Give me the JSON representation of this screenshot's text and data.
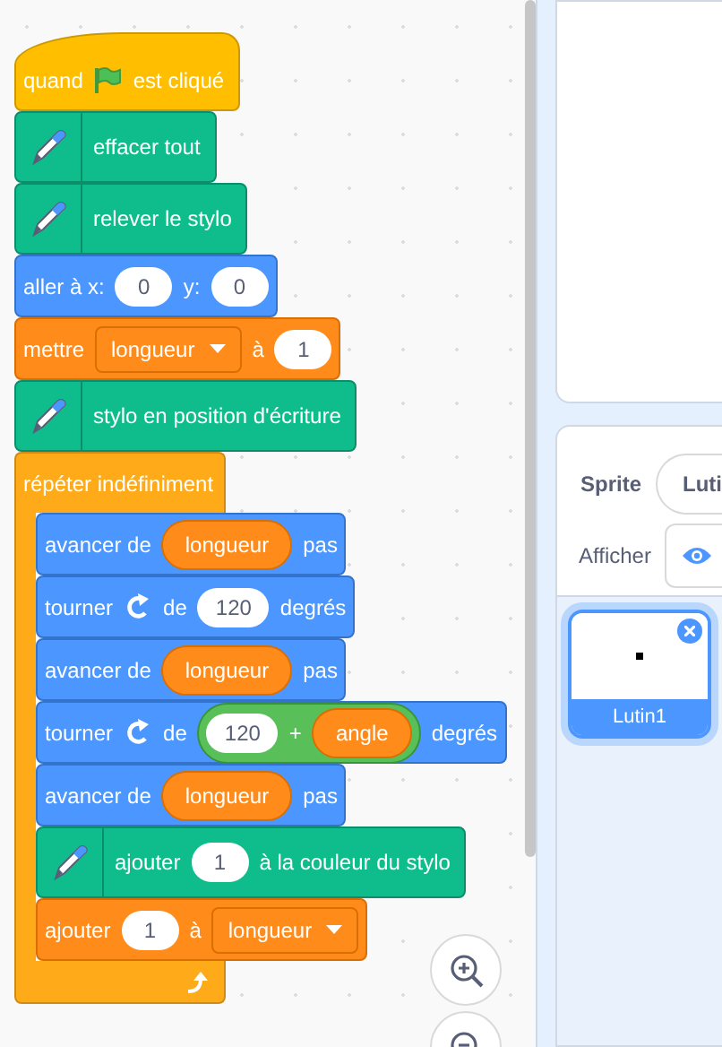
{
  "code_area": {
    "script": [
      {
        "kind": "hat",
        "parts": [
          {
            "kind": "text",
            "text": "quand"
          },
          {
            "kind": "flag"
          },
          {
            "kind": "text",
            "text": "est cliqué"
          }
        ]
      },
      {
        "kind": "pen",
        "parts": [
          {
            "kind": "text",
            "text": "effacer tout"
          }
        ]
      },
      {
        "kind": "pen",
        "parts": [
          {
            "kind": "text",
            "text": "relever le stylo"
          }
        ]
      },
      {
        "kind": "motion",
        "parts": [
          {
            "kind": "text",
            "text": "aller à x:"
          },
          {
            "kind": "number",
            "text": "0"
          },
          {
            "kind": "text",
            "text": "y:"
          },
          {
            "kind": "number",
            "text": "0"
          }
        ]
      },
      {
        "kind": "variables",
        "parts": [
          {
            "kind": "text",
            "text": "mettre"
          },
          {
            "kind": "dropdown",
            "text": "longueur"
          },
          {
            "kind": "text",
            "text": "à"
          },
          {
            "kind": "number",
            "text": "1"
          }
        ]
      },
      {
        "kind": "pen",
        "parts": [
          {
            "kind": "text",
            "text": "stylo en position d'écriture"
          }
        ]
      },
      {
        "kind": "control",
        "parts": [
          {
            "kind": "text",
            "text": "répéter indéfiniment"
          }
        ],
        "body": [
          {
            "kind": "motion",
            "parts": [
              {
                "kind": "text",
                "text": "avancer de"
              },
              {
                "kind": "reporter",
                "text": "longueur"
              },
              {
                "kind": "text",
                "text": "pas"
              }
            ]
          },
          {
            "kind": "motion",
            "parts": [
              {
                "kind": "text",
                "text": "tourner"
              },
              {
                "kind": "turn"
              },
              {
                "kind": "text",
                "text": "de"
              },
              {
                "kind": "number",
                "text": "120"
              },
              {
                "kind": "text",
                "text": "degrés"
              }
            ]
          },
          {
            "kind": "motion",
            "parts": [
              {
                "kind": "text",
                "text": "avancer de"
              },
              {
                "kind": "reporter",
                "text": "longueur"
              },
              {
                "kind": "text",
                "text": "pas"
              }
            ]
          },
          {
            "kind": "motion",
            "parts": [
              {
                "kind": "text",
                "text": "tourner"
              },
              {
                "kind": "turn"
              },
              {
                "kind": "text",
                "text": "de"
              },
              {
                "kind": "operator",
                "parts": [
                  {
                    "kind": "number",
                    "text": "120"
                  },
                  {
                    "kind": "text",
                    "text": "+"
                  },
                  {
                    "kind": "reporter",
                    "text": "angle"
                  }
                ]
              },
              {
                "kind": "text",
                "text": "degrés"
              }
            ]
          },
          {
            "kind": "motion",
            "parts": [
              {
                "kind": "text",
                "text": "avancer de"
              },
              {
                "kind": "reporter",
                "text": "longueur"
              },
              {
                "kind": "text",
                "text": "pas"
              }
            ]
          },
          {
            "kind": "pen",
            "parts": [
              {
                "kind": "text",
                "text": "ajouter"
              },
              {
                "kind": "number",
                "text": "1"
              },
              {
                "kind": "text",
                "text": "à la couleur du stylo"
              }
            ]
          },
          {
            "kind": "variables",
            "parts": [
              {
                "kind": "text",
                "text": "ajouter"
              },
              {
                "kind": "number",
                "text": "1"
              },
              {
                "kind": "text",
                "text": "à"
              },
              {
                "kind": "dropdown",
                "text": "longueur"
              }
            ]
          }
        ]
      }
    ]
  },
  "zoom_controls": [
    {
      "kind": "zoom-in"
    },
    {
      "kind": "zoom-out"
    }
  ],
  "sprite_info": {
    "sprite_label": "Sprite",
    "sprite_name": "Luti",
    "show_label": "Afficher"
  },
  "sprites": [
    {
      "name": "Lutin1",
      "selected": true
    }
  ]
}
